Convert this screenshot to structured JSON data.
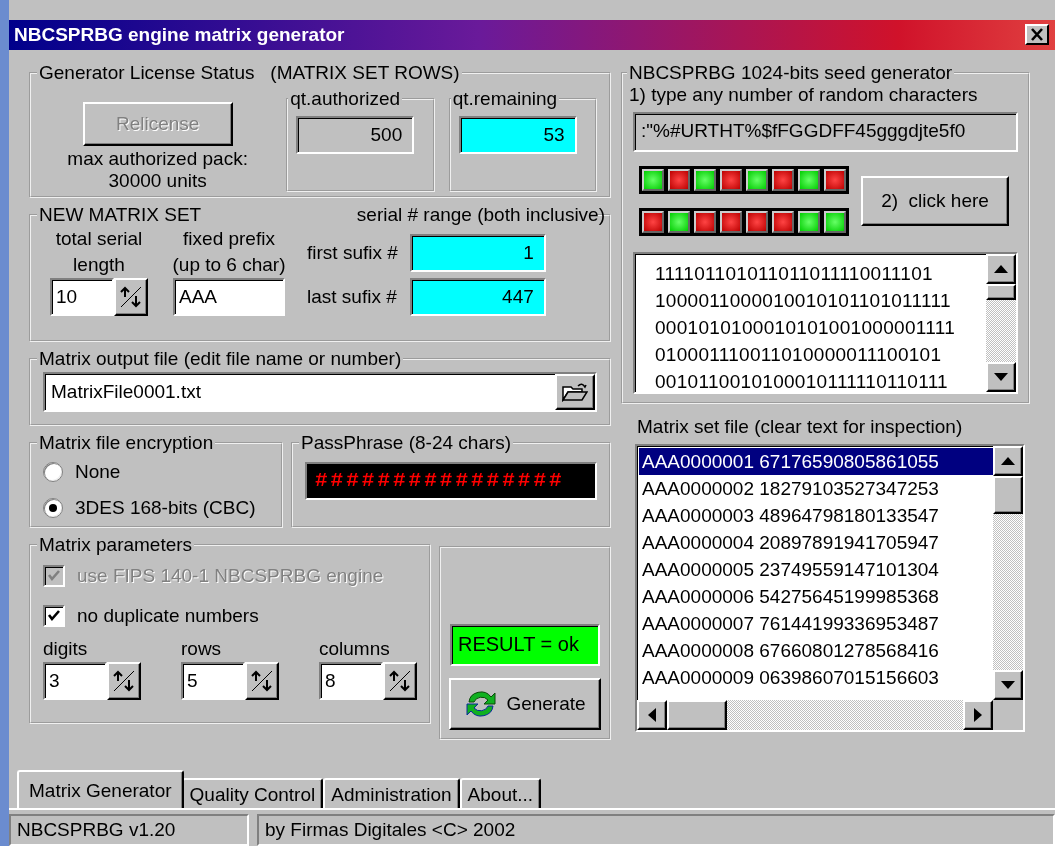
{
  "window": {
    "title": "NBCSPRBG engine matrix generator"
  },
  "license": {
    "title": "Generator License Status",
    "subtitle": "(MATRIX SET ROWS)",
    "relicense_button": {
      "label": "Relicense",
      "disabled": true
    },
    "max_pack": "max authorized pack:",
    "max_units": "30000 units",
    "authorized": {
      "label": "qt.authorized",
      "value": "500"
    },
    "remaining": {
      "label": "qt.remaining",
      "value": "53"
    }
  },
  "new_matrix_set": {
    "title": "NEW MATRIX SET",
    "range_title": "serial # range (both inclusive)",
    "serial_length": {
      "label": "total serial\nlength",
      "value": "10"
    },
    "prefix": {
      "label": "fixed prefix\n(up to 6 char)",
      "value": "AAA"
    },
    "first_suffix": {
      "label": "first sufix #",
      "value": "1"
    },
    "last_suffix": {
      "label": "last sufix #",
      "value": "447"
    }
  },
  "output_file": {
    "title": "Matrix output file  (edit file name or number)",
    "value": "MatrixFile0001.txt"
  },
  "encryption": {
    "title": "Matrix file encryption",
    "options": [
      {
        "label": "None",
        "selected": false
      },
      {
        "label": "3DES 168-bits (CBC)",
        "selected": true
      }
    ]
  },
  "passphrase": {
    "title": "PassPhrase (8-24 chars)",
    "value": "################"
  },
  "parameters": {
    "title": "Matrix parameters",
    "options": [
      {
        "label": "use FIPS 140-1 NBCSPRBG engine",
        "checked": true,
        "disabled": true
      },
      {
        "label": "no duplicate numbers",
        "checked": true,
        "disabled": false
      }
    ],
    "spinners": [
      {
        "label": "digits",
        "value": "3"
      },
      {
        "label": "rows",
        "value": "5"
      },
      {
        "label": "columns",
        "value": "8"
      }
    ]
  },
  "result": "RESULT = ok",
  "generate_button": "Generate",
  "seed": {
    "title": "NBCSPRBG 1024-bits seed generator",
    "instruction": "1) type any number of random characters",
    "value": ":\"%#URTHT%$fFGGDFF45gggdjte5f0",
    "leds": [
      [
        {
          "on": true
        },
        {
          "on": false
        },
        {
          "on": true
        },
        {
          "on": false
        },
        {
          "on": true
        },
        {
          "on": false
        },
        {
          "on": true
        },
        {
          "on": false
        }
      ],
      [
        {
          "on": false
        },
        {
          "on": true
        },
        {
          "on": false
        },
        {
          "on": false
        },
        {
          "on": false
        },
        {
          "on": false
        },
        {
          "on": true
        },
        {
          "on": true
        }
      ]
    ],
    "click_button": "2)  click here",
    "bits": [
      "111101101011011011110011101",
      "1000011000010010101101011111",
      "0001010100010101001000001111",
      "010001110011010000011100101",
      "0010110010100010111110110111"
    ]
  },
  "matrix_file": {
    "title": "Matrix set file (clear text for inspection)",
    "rows": [
      {
        "text": "AAA0000001 67176590805861055",
        "selected": true
      },
      {
        "text": "AAA0000002 18279103527347253",
        "selected": false
      },
      {
        "text": "AAA0000003 48964798180133547",
        "selected": false
      },
      {
        "text": "AAA0000004 20897891941705947",
        "selected": false
      },
      {
        "text": "AAA0000005 23749559147101304",
        "selected": false
      },
      {
        "text": "AAA0000006 54275645199985368",
        "selected": false
      },
      {
        "text": "AAA0000007 76144199336953487",
        "selected": false
      },
      {
        "text": "AAA0000008 67660801278568416",
        "selected": false
      },
      {
        "text": "AAA0000009 06398607015156603",
        "selected": false
      }
    ]
  },
  "tabs": [
    {
      "label": "Matrix Generator",
      "selected": true
    },
    {
      "label": "Quality Control",
      "selected": false
    },
    {
      "label": "Administration",
      "selected": false
    },
    {
      "label": "About...",
      "selected": false
    }
  ],
  "status_bar": [
    "NBCSPRBG v1.20",
    "by Firmas Digitales <C> 2002"
  ]
}
